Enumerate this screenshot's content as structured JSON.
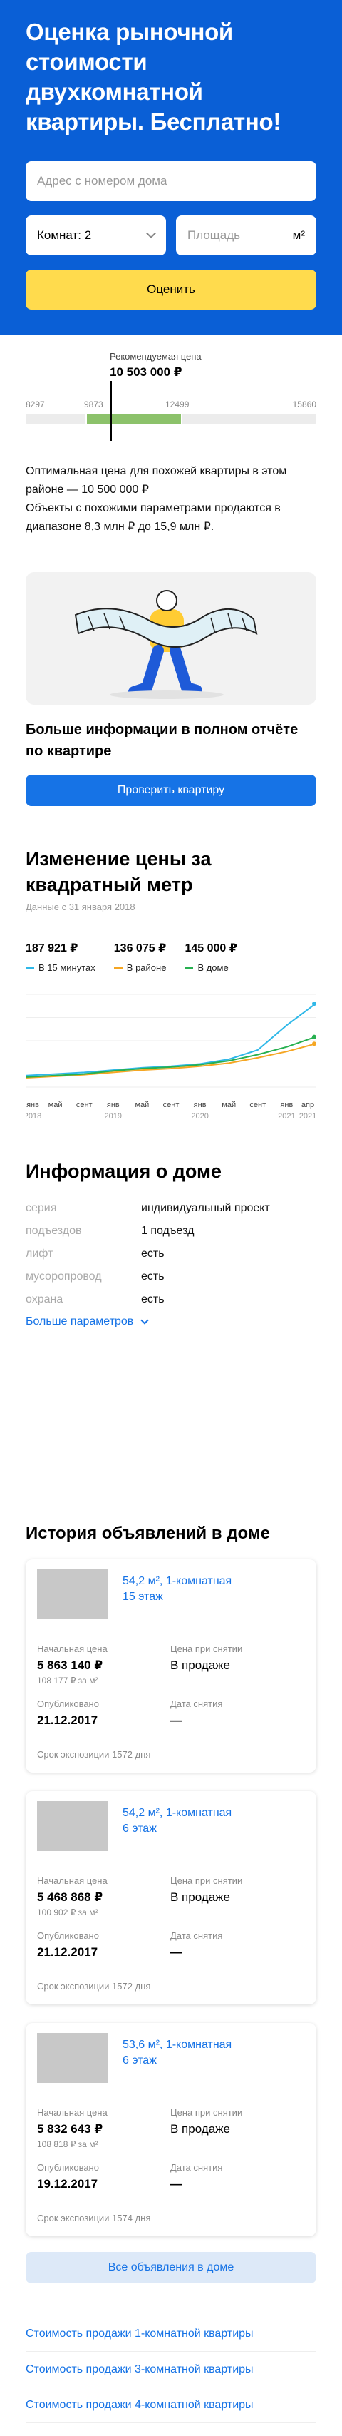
{
  "hero": {
    "title": "Оценка рыночной стоимости двухкомнатной квартиры. Бесплатно!",
    "address_placeholder": "Адрес с номером дома",
    "rooms_value": "Комнат: 2",
    "area_placeholder": "Площадь",
    "area_unit": "м²",
    "estimate_button": "Оценить"
  },
  "price_scale": {
    "recommended_label": "Рекомендуемая цена",
    "recommended_value": "10 503 000 ₽",
    "ticks": [
      "8297",
      "9873",
      "12499",
      "15860"
    ],
    "colors": {
      "fill": "#8cc26b",
      "track": "#ececec"
    }
  },
  "description": "Оптимальная цена для похожей квартиры в этом районе — 10 500 000 ₽\nОбъекты с похожими параметрами продаются в диапазоне 8,3 млн ₽ до 15,9 млн ₽.",
  "promo": {
    "title": "Больше информации в полном отчёте по квартире",
    "button": "Проверить квартиру"
  },
  "price_change": {
    "title": "Изменение цены за квадратный метр",
    "subtitle": "Данные с 31 января 2018",
    "stats": [
      {
        "value": "187 921 ₽",
        "legend": "В 15 минутах",
        "color": "#2fb8e8"
      },
      {
        "value": "136 075 ₽",
        "legend": "В районе",
        "color": "#f5a623"
      },
      {
        "value": "145 000 ₽",
        "legend": "В доме",
        "color": "#27b050"
      }
    ]
  },
  "chart_data": {
    "type": "line",
    "x": [
      "янв 2018",
      "май",
      "сент",
      "янв 2019",
      "май",
      "сент",
      "янв 2020",
      "май",
      "сент",
      "янв",
      "апр 2021"
    ],
    "x_tick_labels": [
      {
        "top": "янв",
        "bottom": "2018"
      },
      {
        "top": "май",
        "bottom": ""
      },
      {
        "top": "сент",
        "bottom": ""
      },
      {
        "top": "янв",
        "bottom": "2019"
      },
      {
        "top": "май",
        "bottom": ""
      },
      {
        "top": "сент",
        "bottom": ""
      },
      {
        "top": "янв",
        "bottom": "2020"
      },
      {
        "top": "май",
        "bottom": ""
      },
      {
        "top": "сент",
        "bottom": ""
      },
      {
        "top": "янв",
        "bottom": "2021"
      },
      {
        "top": "апр",
        "bottom": "2021"
      }
    ],
    "series": [
      {
        "name": "В 15 минутах",
        "color": "#2fb8e8",
        "values": [
          95000,
          97000,
          99000,
          102000,
          105000,
          107000,
          110000,
          116000,
          128000,
          160000,
          187921
        ]
      },
      {
        "name": "В районе",
        "color": "#f5a623",
        "values": [
          92000,
          94000,
          96000,
          99000,
          102000,
          104000,
          107000,
          111000,
          118000,
          126000,
          136075
        ]
      },
      {
        "name": "В доме",
        "color": "#27b050",
        "values": [
          93000,
          95000,
          97000,
          101000,
          104000,
          106000,
          109000,
          114000,
          122000,
          132000,
          145000
        ]
      }
    ],
    "ylim": [
      80000,
      200000
    ],
    "grid": true
  },
  "house": {
    "title": "Информация о доме",
    "rows": [
      {
        "key": "серия",
        "value": "индивидуальный проект"
      },
      {
        "key": "подъездов",
        "value": "1 подъезд"
      },
      {
        "key": "лифт",
        "value": "есть"
      },
      {
        "key": "мусоропровод",
        "value": "есть"
      },
      {
        "key": "охрана",
        "value": "есть"
      }
    ],
    "more": "Больше параметров"
  },
  "history": {
    "title": "История объявлений в доме",
    "labels": {
      "start_price": "Начальная цена",
      "removed_price": "Цена при снятии",
      "published": "Опубликовано",
      "removed_date": "Дата снятия"
    },
    "cards": [
      {
        "link": "54,2 м², 1-комнатная\n15 этаж",
        "start_price": "5 863 140 ₽",
        "per_m2": "108 177 ₽ за м²",
        "status": "В продаже",
        "published": "21.12.2017",
        "removed": "—",
        "exposure": "Срок экспозиции 1572 дня"
      },
      {
        "link": "54,2 м², 1-комнатная\n6 этаж",
        "start_price": "5 468 868 ₽",
        "per_m2": "100 902 ₽ за м²",
        "status": "В продаже",
        "published": "21.12.2017",
        "removed": "—",
        "exposure": "Срок экспозиции 1572 дня"
      },
      {
        "link": "53,6 м², 1-комнатная\n6 этаж",
        "start_price": "5 832 643 ₽",
        "per_m2": "108 818 ₽ за м²",
        "status": "В продаже",
        "published": "19.12.2017",
        "removed": "—",
        "exposure": "Срок экспозиции 1574 дня"
      }
    ],
    "all_button": "Все объявления в доме"
  },
  "bottom_links": [
    "Стоимость продажи 1-комнатной квартиры",
    "Стоимость продажи 3-комнатной квартиры",
    "Стоимость продажи 4-комнатной квартиры"
  ]
}
